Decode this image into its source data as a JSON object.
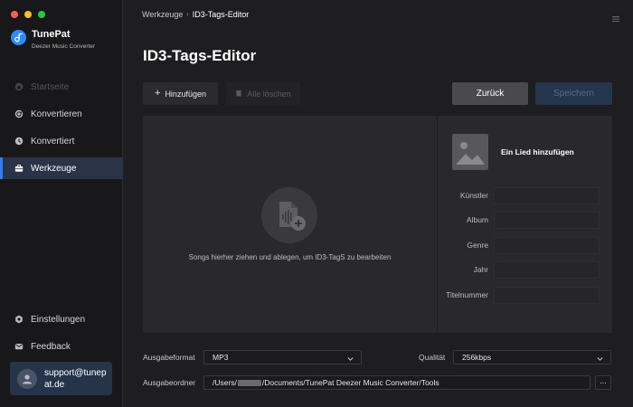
{
  "app": {
    "name": "TunePat",
    "subtitle": "Deezer Music Converter"
  },
  "sidebar": {
    "items": [
      {
        "label": "Startseite",
        "icon": "home-icon",
        "state": "disabled"
      },
      {
        "label": "Konvertieren",
        "icon": "convert-icon",
        "state": "normal"
      },
      {
        "label": "Konvertiert",
        "icon": "clock-icon",
        "state": "normal"
      },
      {
        "label": "Werkzeuge",
        "icon": "toolbox-icon",
        "state": "active"
      }
    ],
    "bottom_items": [
      {
        "label": "Einstellungen",
        "icon": "gear-icon"
      },
      {
        "label": "Feedback",
        "icon": "mail-icon"
      }
    ],
    "account": {
      "email": "support@tunepat.de"
    }
  },
  "header": {
    "breadcrumb_parent": "Werkzeuge",
    "breadcrumb_separator": "›",
    "breadcrumb_current": "ID3-Tags-Editor"
  },
  "page": {
    "title": "ID3-Tags-Editor"
  },
  "toolbar": {
    "add_label": "Hinzufügen",
    "clear_label": "Alle löschen",
    "back_label": "Zurück",
    "save_label": "Speichern"
  },
  "drop_area": {
    "hint": "Songs hierher ziehen und ablegen, um ID3-TagS zu bearbeiten"
  },
  "tag_editor": {
    "add_song_label": "Ein Lied hinzufügen",
    "fields": [
      {
        "label": "Künstler",
        "value": ""
      },
      {
        "label": "Album",
        "value": ""
      },
      {
        "label": "Genre",
        "value": ""
      },
      {
        "label": "Jahr",
        "value": ""
      },
      {
        "label": "Titelnummer",
        "value": ""
      }
    ]
  },
  "output": {
    "format_label": "Ausgabeformat",
    "format_value": "MP3",
    "quality_label": "Qualität",
    "quality_value": "256kbps",
    "folder_label": "Ausgabeordner",
    "folder_prefix": "/Users/",
    "folder_suffix": "/Documents/TunePat Deezer Music Converter/Tools",
    "browse_label": "..."
  },
  "colors": {
    "accent": "#2f7fff",
    "active_bg": "#2a3446",
    "background": "#1e1e20"
  }
}
